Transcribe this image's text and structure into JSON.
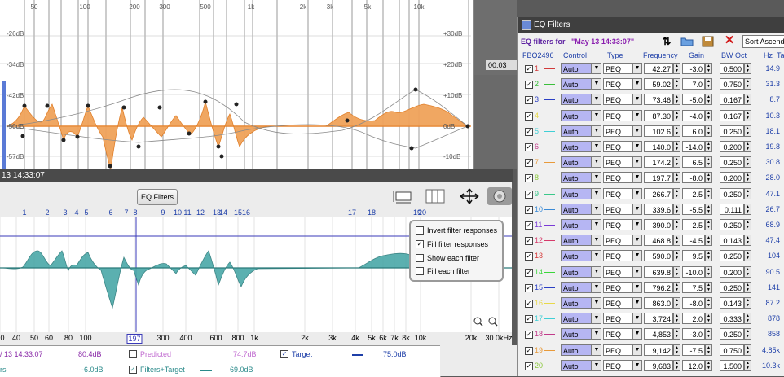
{
  "top_graph": {
    "freq_labels": [
      "50",
      "100",
      "200",
      "300",
      "500",
      "1k",
      "2k",
      "3k",
      "5k",
      "10k"
    ],
    "db_left": [
      "-26dB",
      "-34dB",
      "-42dB",
      "-50dB",
      "-57dB"
    ],
    "db_right": [
      "+30dB",
      "+20dB",
      "+10dB",
      "0dB",
      "-10dB"
    ]
  },
  "background_window": {
    "time_label": "00:03"
  },
  "lower_panel": {
    "title": "13 14:33:07",
    "eq_filters_button": "EQ Filters",
    "filter_numbers": [
      "1",
      "2",
      "3",
      "4",
      "5",
      "6",
      "7",
      "8",
      "9",
      "10",
      "11",
      "12",
      "13",
      "14",
      "15",
      "16",
      "17",
      "18",
      "19",
      "20"
    ],
    "freq_axis": [
      "0",
      "40",
      "50",
      "60",
      "80",
      "100",
      "197",
      "300",
      "400",
      "600",
      "800",
      "1k",
      "2k",
      "3k",
      "4k",
      "5k",
      "6k",
      "7k",
      "8k",
      "10k",
      "20k",
      "30.0kHz"
    ],
    "options": {
      "invert": {
        "label": "Invert filter responses",
        "checked": false
      },
      "fill": {
        "label": "Fill filter responses",
        "checked": true
      },
      "show_each": {
        "label": "Show each filter",
        "checked": false
      },
      "fill_each": {
        "label": "Fill each filter",
        "checked": false
      }
    },
    "cursor_freq": "197"
  },
  "legend": {
    "row1": {
      "name": "/ 13 14:33:07",
      "value": "80.4dB",
      "predicted_label": "Predicted",
      "predicted_value": "74.7dB",
      "target_label": "Target",
      "target_value": "75.0dB"
    },
    "row2": {
      "name": "rs",
      "value": "-6.0dB",
      "ft_label": "Filters+Target",
      "ft_value": "69.0dB"
    }
  },
  "eq_window": {
    "title": "EQ Filters",
    "filters_for_label": "EQ filters for",
    "filters_for_value": "\"May 13 14:33:07\"",
    "sort_label": "Sort Ascend",
    "headers": {
      "device": "FBQ2496",
      "control": "Control",
      "type": "Type",
      "frequency": "Frequency",
      "gain": "Gain",
      "bw": "BW Oct",
      "hz": "Hz",
      "target": "Tar"
    },
    "filters": [
      {
        "n": "1",
        "color": "#d23a3a",
        "control": "Auto",
        "type": "PEQ",
        "freq": "42.27",
        "gain": "-3.0",
        "bw": "0.500",
        "hz": "14.9"
      },
      {
        "n": "2",
        "color": "#3bbf3b",
        "control": "Auto",
        "type": "PEQ",
        "freq": "59.02",
        "gain": "7.0",
        "bw": "0.750",
        "hz": "31.3"
      },
      {
        "n": "3",
        "color": "#2b3fc4",
        "control": "Auto",
        "type": "PEQ",
        "freq": "73.46",
        "gain": "-5.0",
        "bw": "0.167",
        "hz": "8.7"
      },
      {
        "n": "4",
        "color": "#e8d94a",
        "control": "Auto",
        "type": "PEQ",
        "freq": "87.30",
        "gain": "-4.0",
        "bw": "0.167",
        "hz": "10.3"
      },
      {
        "n": "5",
        "color": "#3fcfd6",
        "control": "Auto",
        "type": "PEQ",
        "freq": "102.6",
        "gain": "6.0",
        "bw": "0.250",
        "hz": "18.1"
      },
      {
        "n": "6",
        "color": "#c23a8a",
        "control": "Auto",
        "type": "PEQ",
        "freq": "140.0",
        "gain": "-14.0",
        "bw": "0.200",
        "hz": "19.8"
      },
      {
        "n": "7",
        "color": "#e89a3a",
        "control": "Auto",
        "type": "PEQ",
        "freq": "174.2",
        "gain": "6.5",
        "bw": "0.250",
        "hz": "30.8"
      },
      {
        "n": "8",
        "color": "#8ac83a",
        "control": "Auto",
        "type": "PEQ",
        "freq": "197.7",
        "gain": "-8.0",
        "bw": "0.200",
        "hz": "28.0"
      },
      {
        "n": "9",
        "color": "#3ac88a",
        "control": "Auto",
        "type": "PEQ",
        "freq": "266.7",
        "gain": "2.5",
        "bw": "0.250",
        "hz": "47.1"
      },
      {
        "n": "10",
        "color": "#3a8ad6",
        "control": "Auto",
        "type": "PEQ",
        "freq": "339.6",
        "gain": "-5.5",
        "bw": "0.111",
        "hz": "26.7"
      },
      {
        "n": "11",
        "color": "#7a3ad6",
        "control": "Auto",
        "type": "PEQ",
        "freq": "390.0",
        "gain": "2.5",
        "bw": "0.250",
        "hz": "68.9"
      },
      {
        "n": "12",
        "color": "#d63a6a",
        "control": "Auto",
        "type": "PEQ",
        "freq": "468.8",
        "gain": "-4.5",
        "bw": "0.143",
        "hz": "47.4"
      },
      {
        "n": "13",
        "color": "#d63a3a",
        "control": "Auto",
        "type": "PEQ",
        "freq": "590.0",
        "gain": "9.5",
        "bw": "0.250",
        "hz": "104"
      },
      {
        "n": "14",
        "color": "#3ad63a",
        "control": "Auto",
        "type": "PEQ",
        "freq": "639.8",
        "gain": "-10.0",
        "bw": "0.200",
        "hz": "90.5"
      },
      {
        "n": "15",
        "color": "#2b3fc4",
        "control": "Auto",
        "type": "PEQ",
        "freq": "796.2",
        "gain": "7.5",
        "bw": "0.250",
        "hz": "141"
      },
      {
        "n": "16",
        "color": "#e8d94a",
        "control": "Auto",
        "type": "PEQ",
        "freq": "863.0",
        "gain": "-8.0",
        "bw": "0.143",
        "hz": "87.2"
      },
      {
        "n": "17",
        "color": "#3fcfd6",
        "control": "Auto",
        "type": "PEQ",
        "freq": "3,724",
        "gain": "2.0",
        "bw": "0.333",
        "hz": "878"
      },
      {
        "n": "18",
        "color": "#c23a8a",
        "control": "Auto",
        "type": "PEQ",
        "freq": "4,853",
        "gain": "-3.0",
        "bw": "0.250",
        "hz": "858"
      },
      {
        "n": "19",
        "color": "#e89a3a",
        "control": "Auto",
        "type": "PEQ",
        "freq": "9,142",
        "gain": "-7.5",
        "bw": "0.750",
        "hz": "4.85k"
      },
      {
        "n": "20",
        "color": "#8ac83a",
        "control": "Auto",
        "type": "PEQ",
        "freq": "9,683",
        "gain": "12.0",
        "bw": "1.500",
        "hz": "10.3k"
      }
    ]
  }
}
